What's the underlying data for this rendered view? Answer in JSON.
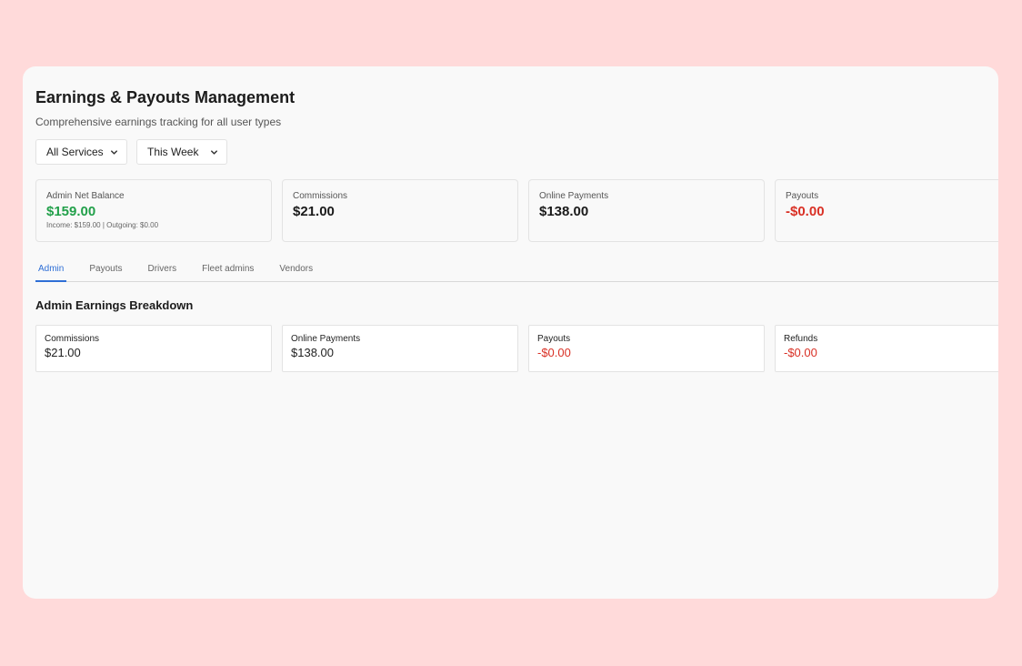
{
  "header": {
    "title": "Earnings & Payouts Management",
    "subtitle": "Comprehensive earnings tracking for all user types"
  },
  "filters": {
    "service": "All Services",
    "period": "This Week"
  },
  "summary_cards": [
    {
      "label": "Admin Net Balance",
      "value": "$159.00",
      "sub": "Income: $159.00 | Outgoing: $0.00"
    },
    {
      "label": "Commissions",
      "value": "$21.00"
    },
    {
      "label": "Online Payments",
      "value": "$138.00"
    },
    {
      "label": "Payouts",
      "value": "-$0.00"
    }
  ],
  "tabs": [
    "Admin",
    "Payouts",
    "Drivers",
    "Fleet admins",
    "Vendors"
  ],
  "breakdown": {
    "title": "Admin Earnings Breakdown",
    "items": [
      {
        "label": "Commissions",
        "value": "$21.00"
      },
      {
        "label": "Online Payments",
        "value": "$138.00"
      },
      {
        "label": "Payouts",
        "value": "-$0.00"
      },
      {
        "label": "Refunds",
        "value": "-$0.00"
      }
    ]
  },
  "colors": {
    "positive": "#22a04a",
    "negative": "#d93025",
    "accent": "#2f6fd6",
    "backdrop": "#ffdada"
  }
}
